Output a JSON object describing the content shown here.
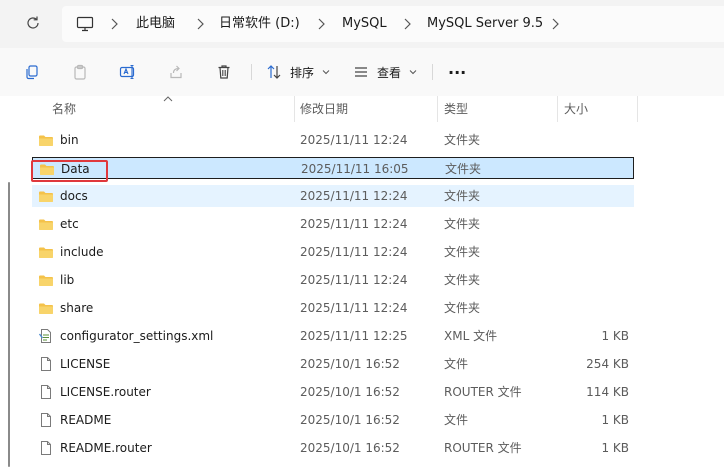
{
  "breadcrumb": [
    {
      "label": "此电脑"
    },
    {
      "label": "日常软件 (D:)"
    },
    {
      "label": "MySQL"
    },
    {
      "label": "MySQL Server 9.5"
    }
  ],
  "toolbar": {
    "sort_label": "排序",
    "view_label": "查看",
    "more_label": "···"
  },
  "columns": {
    "name": "名称",
    "date": "修改日期",
    "type": "类型",
    "size": "大小"
  },
  "files": [
    {
      "name": "bin",
      "date": "2025/11/11 12:24",
      "type": "文件夹",
      "size": "",
      "icon": "folder-icon"
    },
    {
      "name": "Data",
      "date": "2025/11/11 16:05",
      "type": "文件夹",
      "size": "",
      "icon": "folder-icon"
    },
    {
      "name": "docs",
      "date": "2025/11/11 12:24",
      "type": "文件夹",
      "size": "",
      "icon": "folder-icon"
    },
    {
      "name": "etc",
      "date": "2025/11/11 12:24",
      "type": "文件夹",
      "size": "",
      "icon": "folder-icon"
    },
    {
      "name": "include",
      "date": "2025/11/11 12:24",
      "type": "文件夹",
      "size": "",
      "icon": "folder-icon"
    },
    {
      "name": "lib",
      "date": "2025/11/11 12:24",
      "type": "文件夹",
      "size": "",
      "icon": "folder-icon"
    },
    {
      "name": "share",
      "date": "2025/11/11 12:24",
      "type": "文件夹",
      "size": "",
      "icon": "folder-icon"
    },
    {
      "name": "configurator_settings.xml",
      "date": "2025/11/11 12:25",
      "type": "XML 文件",
      "size": "1 KB",
      "icon": "xml-file-icon"
    },
    {
      "name": "LICENSE",
      "date": "2025/10/1 16:52",
      "type": "文件",
      "size": "254 KB",
      "icon": "file-icon"
    },
    {
      "name": "LICENSE.router",
      "date": "2025/10/1 16:52",
      "type": "ROUTER 文件",
      "size": "114 KB",
      "icon": "file-icon"
    },
    {
      "name": "README",
      "date": "2025/10/1 16:52",
      "type": "文件",
      "size": "1 KB",
      "icon": "file-icon"
    },
    {
      "name": "README.router",
      "date": "2025/10/1 16:52",
      "type": "ROUTER 文件",
      "size": "1 KB",
      "icon": "file-icon"
    }
  ],
  "selected_index": 1,
  "hover_index": 2,
  "colors": {
    "selection": "#cce8ff",
    "hover": "#e5f3ff",
    "highlight_box": "#e0383c",
    "folder": "#f4c24a"
  }
}
